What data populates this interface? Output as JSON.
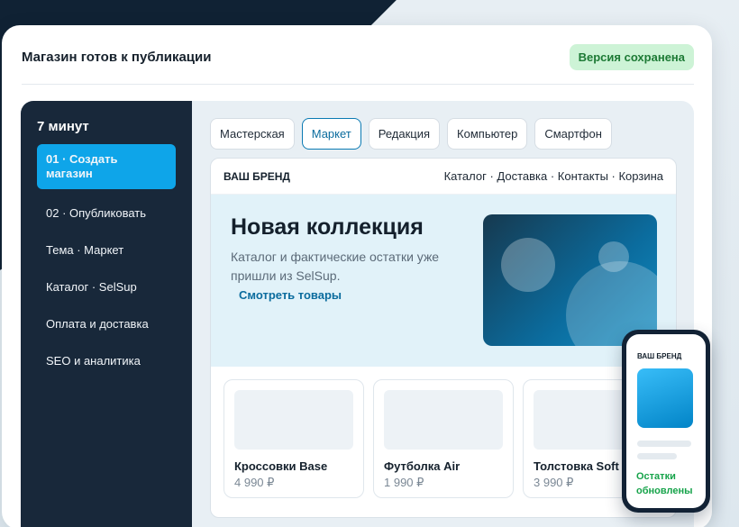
{
  "header": {
    "title": "Магазин готов к публикации",
    "badge": "Версия сохранена"
  },
  "sidebar": {
    "title": "7 минут",
    "items": [
      {
        "label": "01 · Создать магазин",
        "active": true
      },
      {
        "label": "02 · Опубликовать"
      },
      {
        "label": "Тема · Маркет"
      },
      {
        "label": "Каталог · SelSup"
      },
      {
        "label": "Оплата и доставка"
      },
      {
        "label": "SEO и аналитика"
      }
    ]
  },
  "tabs": [
    {
      "label": "Мастерская"
    },
    {
      "label": "Маркет",
      "active": true
    },
    {
      "label": "Редакция"
    },
    {
      "label": "Компьютер"
    },
    {
      "label": "Смартфон"
    }
  ],
  "preview": {
    "brand": "ВАШ БРЕНД",
    "nav_links": "Каталог · Доставка · Контакты · Корзина",
    "hero": {
      "title": "Новая коллекция",
      "text": "Каталог и фактические остатки уже пришли из SelSup.",
      "link": "Смотреть товары"
    },
    "products": [
      {
        "name": "Кроссовки Base",
        "price": "4 990 ₽"
      },
      {
        "name": "Футболка Air",
        "price": "1 990 ₽"
      },
      {
        "name": "Толстовка Soft",
        "price": "3 990 ₽"
      }
    ]
  },
  "phone": {
    "brand": "ВАШ БРЕНД",
    "status": "Остатки обновлены"
  },
  "colors": {
    "accent": "#0ea5e9",
    "sidebar": "#18283a",
    "badge_bg": "#cdf3d6",
    "success": "#16a34a",
    "link": "#0b6c9e"
  }
}
